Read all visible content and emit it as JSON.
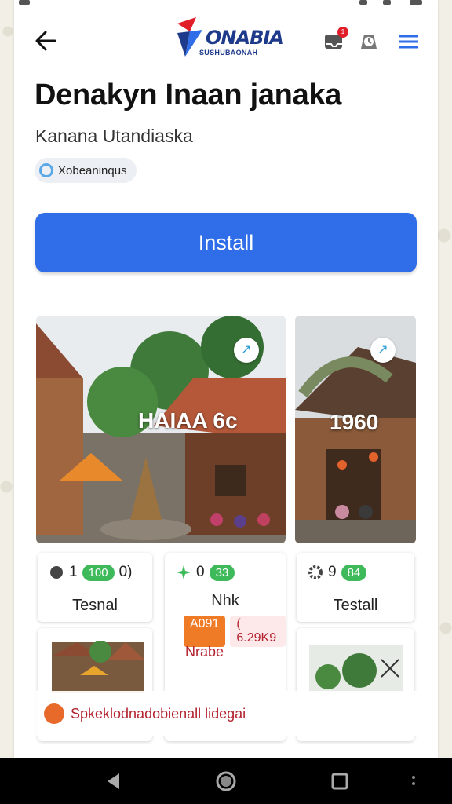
{
  "header": {
    "logo_title": "ONABIA",
    "logo_sub": "SUSHUBAONAH",
    "notification_count": "1"
  },
  "app": {
    "title": "Denakyn Inaan janaka",
    "developer": "Kanana Utandiaska",
    "chip_label": "Xobeaninqus"
  },
  "install_label": "Install",
  "screenshots": [
    {
      "overlay": "HAIAA 6c"
    },
    {
      "overlay": "1960"
    }
  ],
  "tiles": [
    {
      "num": "1",
      "pill": "100",
      "suffix": "0)",
      "label": "Tesnal"
    },
    {
      "num": "0",
      "pill": "33",
      "suffix": "",
      "label": "Nhk",
      "tag_orange": "A091",
      "tag_red": "( 6.29K9",
      "note": "Nrabe"
    },
    {
      "num": "9",
      "pill": "84",
      "suffix": "",
      "label": "Testall"
    }
  ],
  "promo_text": "Spkeklodnadobienall lidegai",
  "colors": {
    "accent": "#2f6ee8",
    "pill_green": "#3fba5a",
    "tag_orange": "#f07b27",
    "promo_red": "#b3232f"
  }
}
